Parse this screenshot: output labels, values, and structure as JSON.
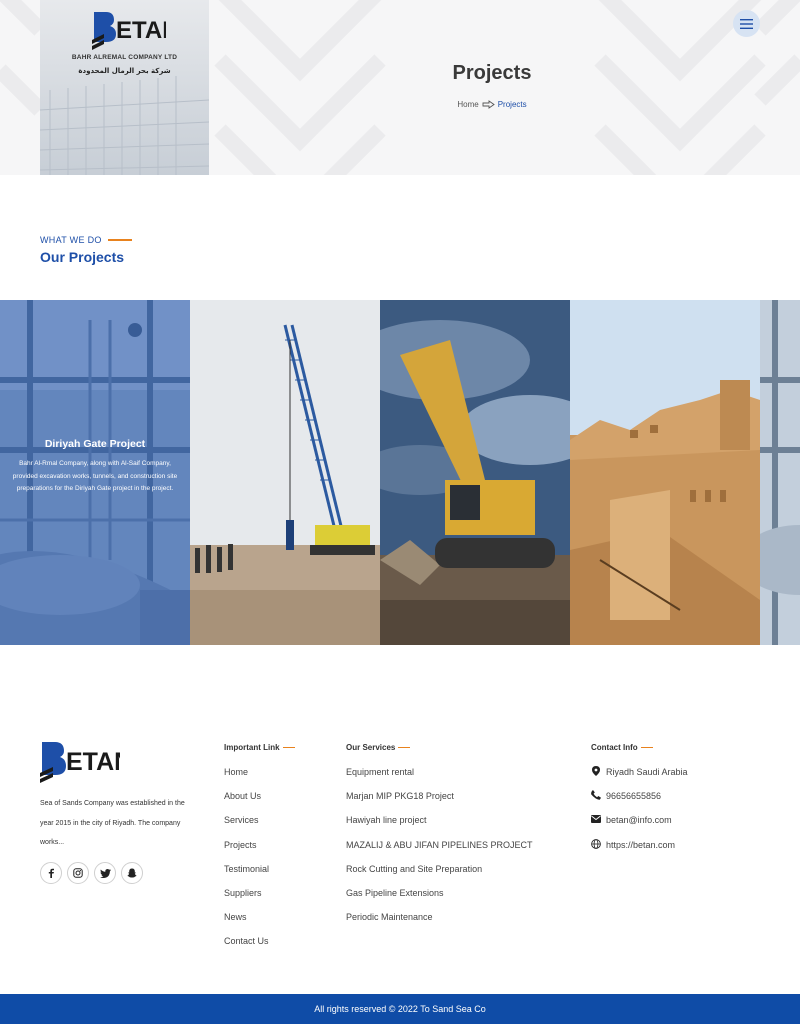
{
  "header": {
    "company_en": "BAHR ALREMAL COMPANY LTD",
    "company_ar": "شركة بحر الرمال المحدودة",
    "logo_text": "ETAN",
    "title": "Projects",
    "breadcrumb": {
      "home": "Home",
      "current": "Projects"
    },
    "menu_icon": "hamburger-icon"
  },
  "section": {
    "eyebrow": "WHAT WE DO",
    "title": "Our Projects"
  },
  "projects": [
    {
      "title": "Diriyah Gate Project",
      "description": "Bahr Al-Rmal Company, along with Al-Saif Company, provided excavation works, tunnels, and construction site preparations for the Diriyah Gate project in the project.",
      "image": "industrial-pipes"
    },
    {
      "image": "crane-site"
    },
    {
      "image": "excavator"
    },
    {
      "image": "mud-brick-ruins"
    },
    {
      "image": "industrial-pipes"
    }
  ],
  "footer": {
    "logo_text": "ETAN",
    "about": "Sea of Sands Company was established in the year 2015 in the city of Riyadh. The company works...",
    "socials": [
      "facebook-icon",
      "instagram-icon",
      "twitter-icon",
      "snapchat-icon"
    ],
    "important_links": {
      "title": "Important Link",
      "items": [
        "Home",
        "About Us",
        "Services",
        "Projects",
        "Testimonial",
        "Suppliers",
        "News",
        "Contact Us"
      ]
    },
    "services": {
      "title": "Our Services",
      "items": [
        "Equipment rental",
        "Marjan MIP PKG18 Project",
        "Hawiyah line project",
        "MAZALIJ & ABU JIFAN PIPELINES PROJECT",
        "Rock Cutting and Site Preparation",
        "Gas Pipeline Extensions",
        "Periodic Maintenance"
      ]
    },
    "contact": {
      "title": "Contact Info",
      "address": "Riyadh Saudi Arabia",
      "phone": "96656655856",
      "email": "betan@info.com",
      "website": "https://betan.com"
    },
    "copyright": "All rights reserved © 2022 To Sand Sea Co"
  },
  "colors": {
    "brand_blue": "#1e4fa8",
    "accent_orange": "#e8821e",
    "bar_blue": "#0f4ca7"
  }
}
